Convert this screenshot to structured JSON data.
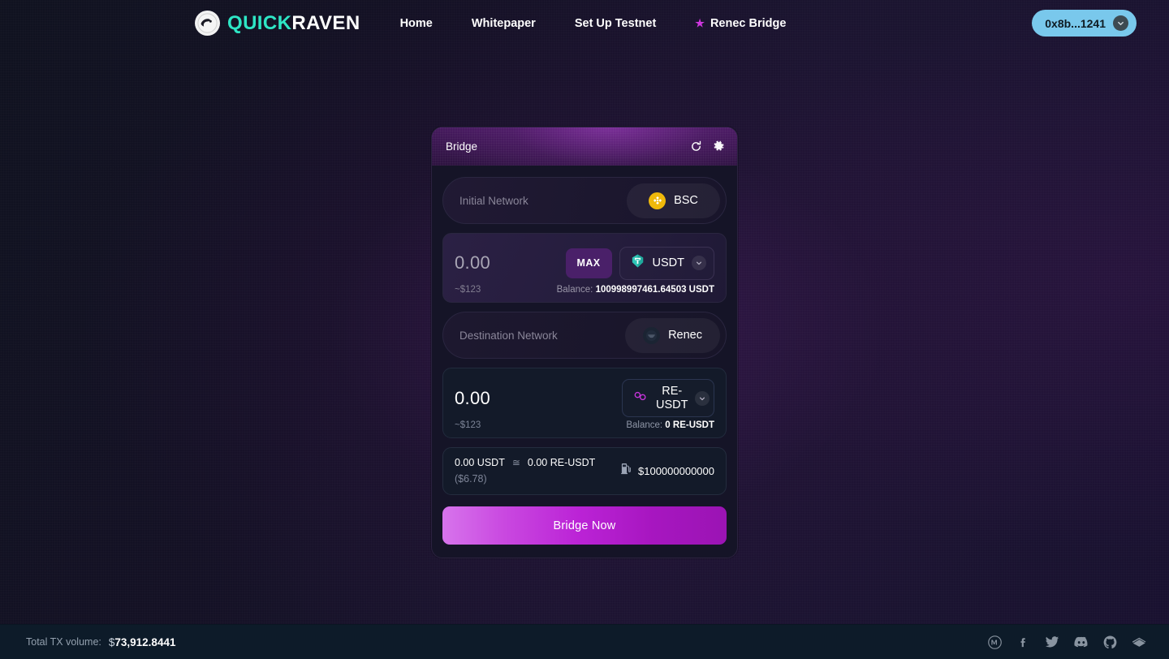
{
  "nav": {
    "logo": {
      "part1": "QUICK",
      "part2": "RAVEN",
      "icon": "raven-logo-icon"
    },
    "links": [
      {
        "label": "Home",
        "starred": false
      },
      {
        "label": "Whitepaper",
        "starred": false
      },
      {
        "label": "Set Up Testnet",
        "starred": false
      },
      {
        "label": "Renec Bridge",
        "starred": true
      }
    ],
    "wallet": {
      "address": "0x8b...1241",
      "chevron_icon": "chevron-down-icon"
    },
    "accent_star_color": "#cf37e0",
    "wallet_bg_color": "#79c8ec"
  },
  "card": {
    "title": "Bridge",
    "refresh_icon": "refresh-icon",
    "settings_icon": "gear-icon",
    "initial_network": {
      "label": "Initial Network",
      "value": "BSC",
      "icon": "bsc-chain-icon",
      "icon_color": "#f0b90b"
    },
    "source_amount": {
      "value": "0.00",
      "usd": "~$123",
      "max_label": "MAX",
      "token": "USDT",
      "token_icon": "usdt-tether-icon",
      "token_icon_color": "#2ec4b6",
      "chevron_icon": "chevron-down-icon",
      "balance_label": "Balance:",
      "balance_value": "100998997461.64503 USDT"
    },
    "destination_network": {
      "label": "Destination Network",
      "value": "Renec",
      "icon": "renec-chain-icon"
    },
    "dest_amount": {
      "value": "0.00",
      "usd": "~$123",
      "token": "RE-USDT",
      "token_icon": "re-usdt-icon",
      "token_icon_color": "#c935dd",
      "chevron_icon": "chevron-down-icon",
      "balance_label": "Balance:",
      "balance_value": "0 RE-USDT"
    },
    "rate": {
      "from": "0.00 USDT",
      "approx_symbol": "≅",
      "to": "0.00 RE-USDT",
      "usd": "($6.78)",
      "gas_icon": "gas-pump-icon",
      "gas_amount": "$100000000000"
    },
    "submit_label": "Bridge Now",
    "accent_color": "#bb35e6"
  },
  "footer": {
    "tx_label": "Total TX volume:",
    "tx_currency": "$",
    "tx_value": "73,912.8441",
    "socials": [
      {
        "name": "medium-icon"
      },
      {
        "name": "facebook-icon"
      },
      {
        "name": "twitter-icon"
      },
      {
        "name": "discord-icon"
      },
      {
        "name": "github-icon"
      },
      {
        "name": "gitbook-icon"
      }
    ]
  }
}
